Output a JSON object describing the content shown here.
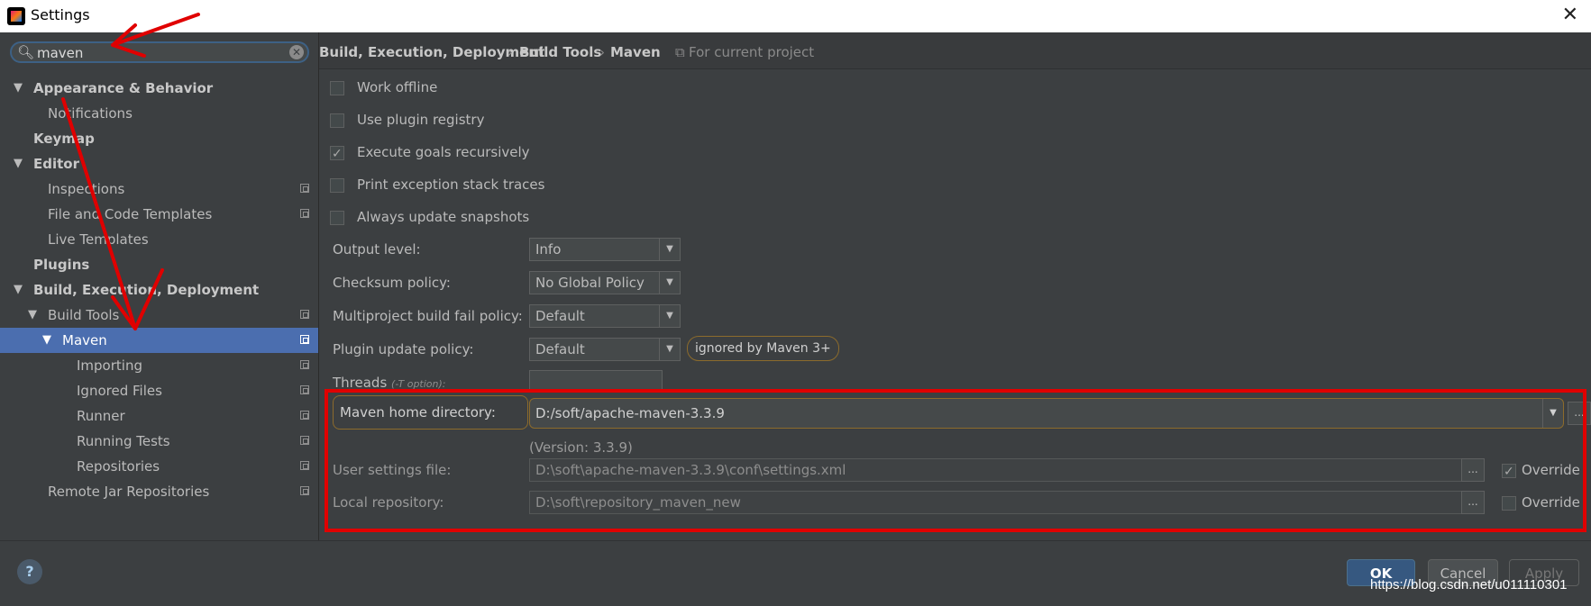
{
  "window": {
    "title": "Settings"
  },
  "search": {
    "value": "maven"
  },
  "tree": [
    {
      "label": "Appearance & Behavior",
      "level": 0,
      "expanded": true,
      "bold": true
    },
    {
      "label": "Notifications",
      "level": 1
    },
    {
      "label": "Keymap",
      "level": 0,
      "bold": true
    },
    {
      "label": "Editor",
      "level": 0,
      "expanded": true,
      "bold": true
    },
    {
      "label": "Inspections",
      "level": 1,
      "project": true
    },
    {
      "label": "File and Code Templates",
      "level": 1,
      "project": true
    },
    {
      "label": "Live Templates",
      "level": 1
    },
    {
      "label": "Plugins",
      "level": 0,
      "bold": true
    },
    {
      "label": "Build, Execution, Deployment",
      "level": 0,
      "expanded": true,
      "bold": true
    },
    {
      "label": "Build Tools",
      "level": 1,
      "expanded": true,
      "project": true
    },
    {
      "label": "Maven",
      "level": 2,
      "expanded": true,
      "project": true,
      "selected": true
    },
    {
      "label": "Importing",
      "level": 3,
      "project": true
    },
    {
      "label": "Ignored Files",
      "level": 3,
      "project": true
    },
    {
      "label": "Runner",
      "level": 3,
      "project": true
    },
    {
      "label": "Running Tests",
      "level": 3,
      "project": true
    },
    {
      "label": "Repositories",
      "level": 3,
      "project": true
    },
    {
      "label": "Remote Jar Repositories",
      "level": 1,
      "project": true
    }
  ],
  "breadcrumb": {
    "items": [
      "Build, Execution, Deployment",
      "Build Tools",
      "Maven"
    ],
    "separator": "›",
    "scope": "For current project"
  },
  "options": {
    "work_offline": {
      "label": "Work offline",
      "checked": false
    },
    "use_plugin_registry": {
      "label": "Use plugin registry",
      "checked": false
    },
    "execute_goals_recursively": {
      "label": "Execute goals recursively",
      "checked": true
    },
    "print_exception_stack_traces": {
      "label": "Print exception stack traces",
      "checked": false
    },
    "always_update_snapshots": {
      "label": "Always update snapshots",
      "checked": false
    }
  },
  "output_level": {
    "label": "Output level:",
    "value": "Info"
  },
  "checksum_policy": {
    "label": "Checksum policy:",
    "value": "No Global Policy"
  },
  "multiproject_fail_policy": {
    "label": "Multiproject build fail policy:",
    "value": "Default"
  },
  "plugin_update_policy": {
    "label": "Plugin update policy:",
    "value": "Default",
    "note": "ignored by Maven 3+"
  },
  "threads": {
    "label": "Threads",
    "hint": "(-T option):",
    "value": ""
  },
  "maven_home": {
    "label": "Maven home directory:",
    "value": "D:/soft/apache-maven-3.3.9",
    "version": "(Version: 3.3.9)"
  },
  "user_settings": {
    "label": "User settings file:",
    "value": "D:\\soft\\apache-maven-3.3.9\\conf\\settings.xml",
    "override_label": "Override",
    "override": true
  },
  "local_repository": {
    "label": "Local repository:",
    "value": "D:\\soft\\repository_maven_new",
    "override_label": "Override",
    "override": false
  },
  "buttons": {
    "ok": "OK",
    "cancel": "Cancel",
    "apply": "Apply",
    "help": "?"
  },
  "browse_label": "...",
  "watermark": "https://blog.csdn.net/u011110301",
  "colors": {
    "selection": "#4b6eaf",
    "highlight_box": "#e00000",
    "annotation_arrow": "#e00000"
  }
}
